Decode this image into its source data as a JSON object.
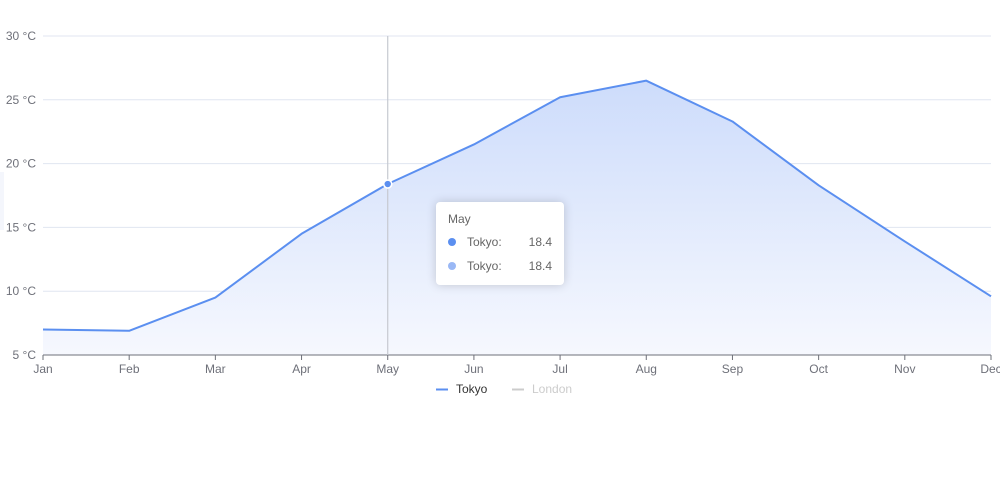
{
  "chart_data": {
    "type": "area",
    "categories": [
      "Jan",
      "Feb",
      "Mar",
      "Apr",
      "May",
      "Jun",
      "Jul",
      "Aug",
      "Sep",
      "Oct",
      "Nov",
      "Dec"
    ],
    "series": [
      {
        "name": "Tokyo",
        "values": [
          7.0,
          6.9,
          9.5,
          14.5,
          18.4,
          21.5,
          25.2,
          26.5,
          23.3,
          18.3,
          13.9,
          9.6
        ],
        "color": "#5b8ff0",
        "visible": true
      },
      {
        "name": "London",
        "values": [],
        "color": "#cccccc",
        "visible": false
      }
    ],
    "y_ticks": [
      "5 °C",
      "10 °C",
      "15 °C",
      "20 °C",
      "25 °C",
      "30 °C"
    ],
    "ylim": [
      5,
      30
    ],
    "grid": true,
    "legend_position": "bottom-center",
    "highlight_index": 4,
    "fill_gradient": [
      "#cddcfb",
      "#f6f8fe"
    ]
  },
  "tooltip": {
    "title": "May",
    "rows": [
      {
        "name": "Tokyo:",
        "value": "18.4",
        "color": "#5b8ff0"
      },
      {
        "name": "Tokyo:",
        "value": "18.4",
        "color": "#9ab8f5"
      }
    ]
  }
}
